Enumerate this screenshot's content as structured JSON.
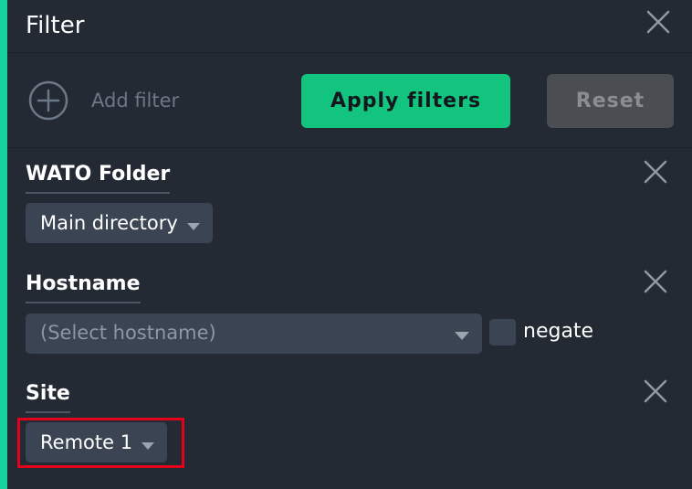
{
  "panel": {
    "title": "Filter",
    "accent_color": "#15d1a0"
  },
  "toolbar": {
    "add_filter_label": "Add filter",
    "apply_label": "Apply filters",
    "reset_label": "Reset",
    "apply_color": "#13c47e"
  },
  "filters": {
    "wato_folder": {
      "title": "WATO Folder",
      "selected": "Main directory"
    },
    "hostname": {
      "title": "Hostname",
      "placeholder": "(Select hostname)",
      "negate_label": "negate",
      "negate_checked": false
    },
    "site": {
      "title": "Site",
      "selected": "Remote 1"
    }
  },
  "annotation": {
    "highlight_color": "#e4001a"
  }
}
